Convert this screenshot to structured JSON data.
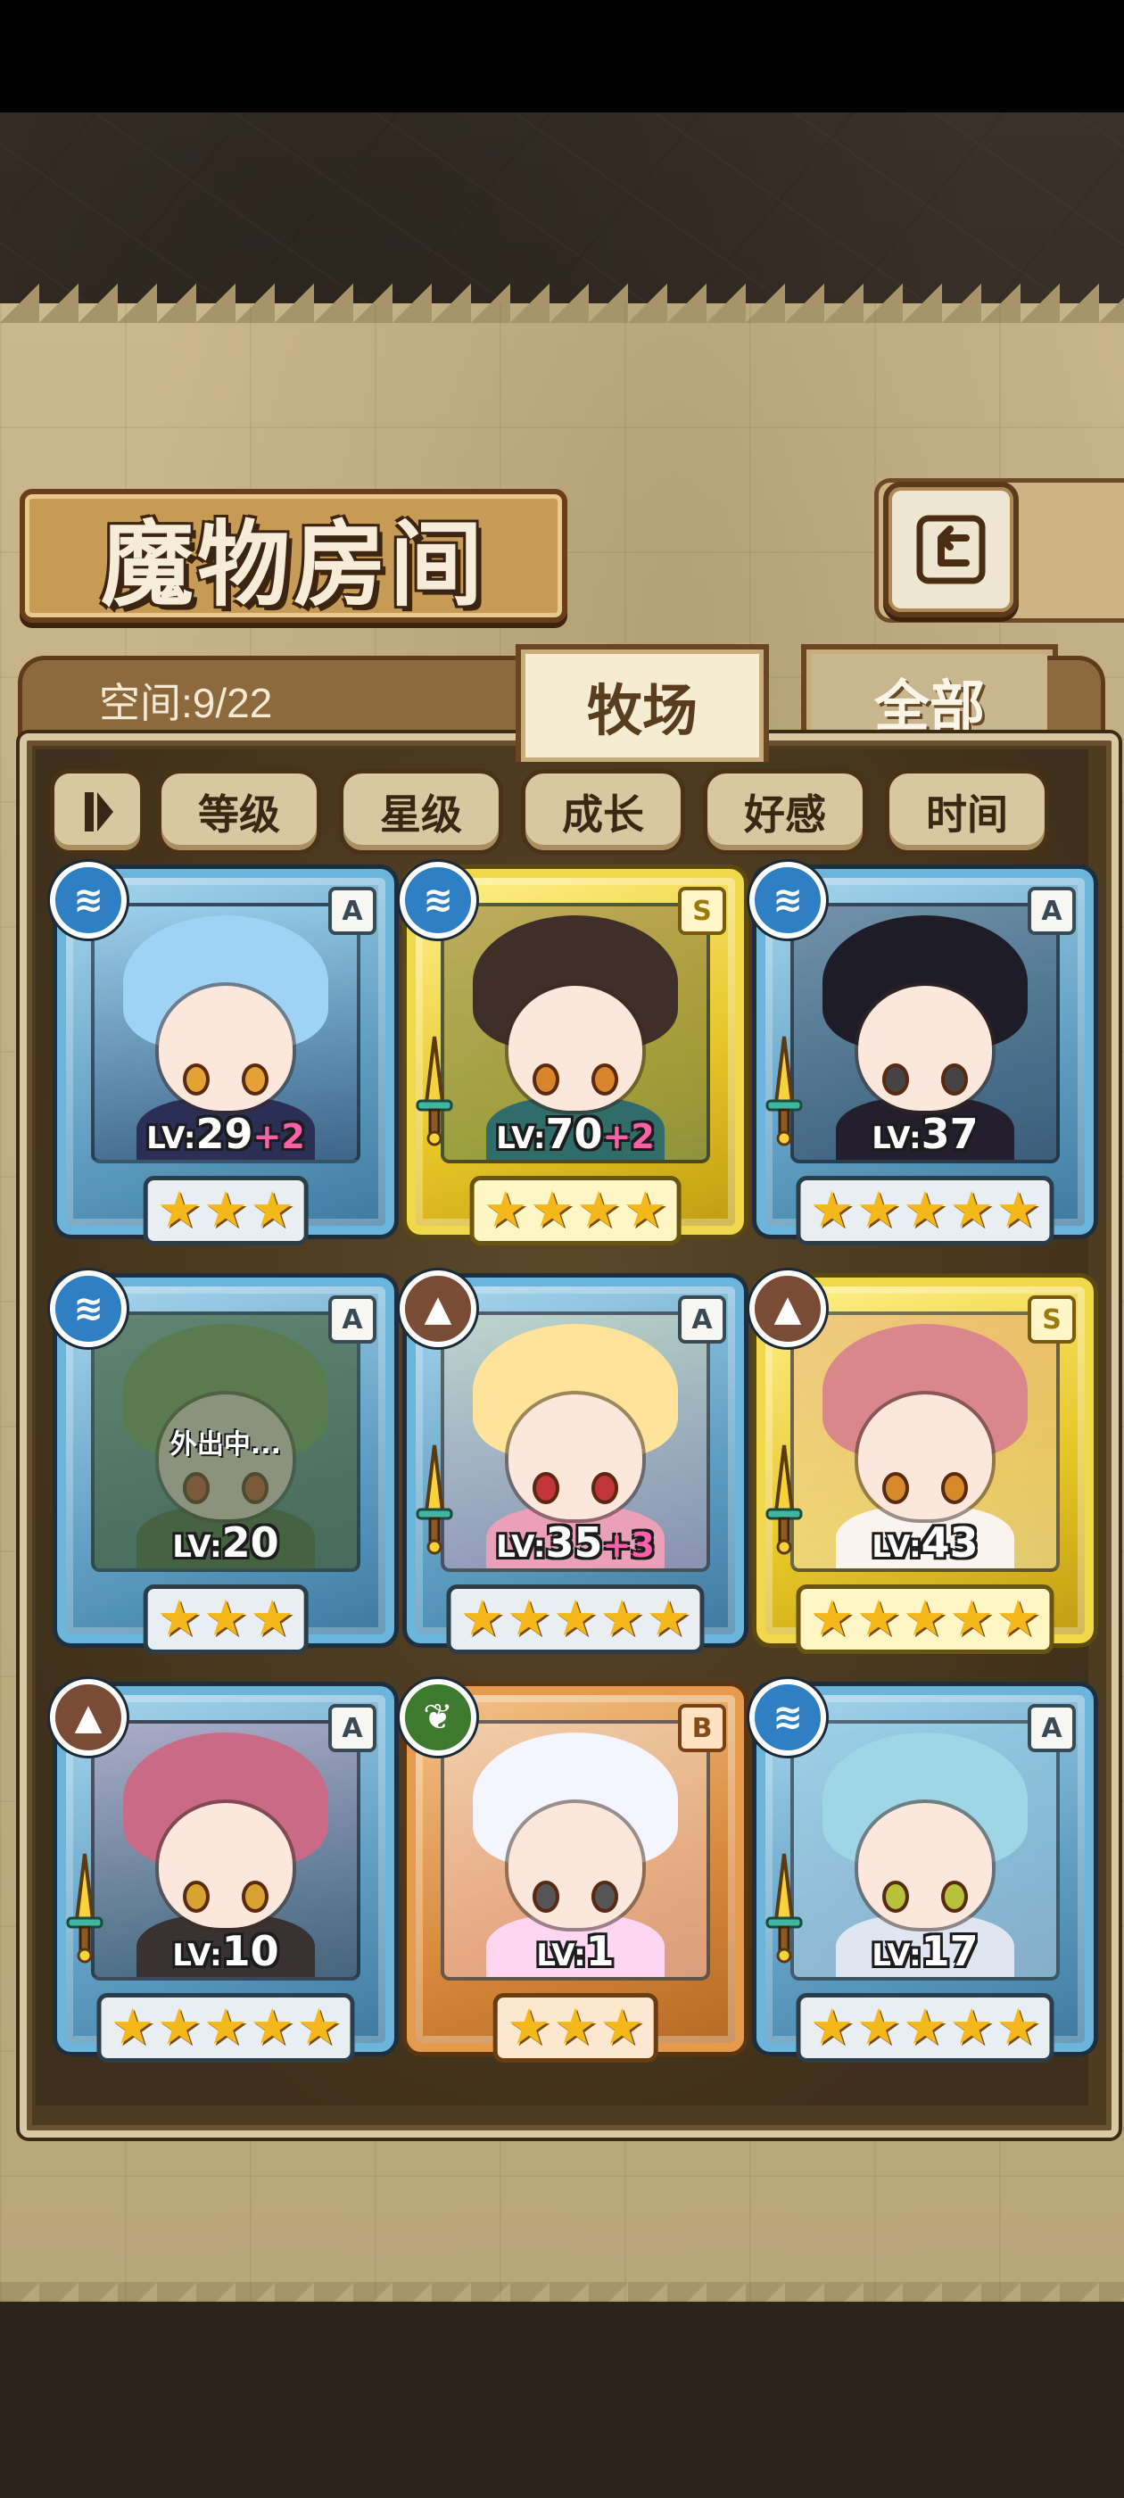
{
  "header": {
    "title": "魔物房间",
    "back_icon": "return-arrow-icon"
  },
  "tabs": {
    "space_label": "空间:9/22",
    "ranch": "牧场",
    "all": "全部",
    "active": "牧场"
  },
  "sort_buttons": [
    {
      "label": "等级"
    },
    {
      "label": "星级"
    },
    {
      "label": "成长"
    },
    {
      "label": "好感"
    },
    {
      "label": "时间"
    }
  ],
  "monsters": [
    {
      "level": "29",
      "bonus": "+2",
      "stars": 3,
      "rank": "A",
      "element": "water",
      "frame": "blue",
      "status": "",
      "hair": "#9fd3f5",
      "body": "#2c2f55",
      "eye": "#e3a233"
    },
    {
      "level": "70",
      "bonus": "+2",
      "stars": 4,
      "rank": "S",
      "element": "water",
      "frame": "gold",
      "status": "",
      "hair": "#3e3028",
      "body": "#2f6c6a",
      "eye": "#d9832b"
    },
    {
      "level": "37",
      "bonus": "",
      "stars": 5,
      "rank": "A",
      "element": "water",
      "frame": "blue",
      "status": "",
      "hair": "#1e1c28",
      "body": "#241f2e",
      "eye": "#444"
    },
    {
      "level": "20",
      "bonus": "",
      "stars": 3,
      "rank": "A",
      "element": "water",
      "frame": "blue",
      "status": "外出中...",
      "hair": "#7aa95f",
      "body": "#496b3a",
      "eye": "#d8502c"
    },
    {
      "level": "35",
      "bonus": "+3",
      "stars": 5,
      "rank": "A",
      "element": "earth",
      "frame": "blue",
      "status": "",
      "hair": "#ffe39a",
      "body": "#e9a0b8",
      "eye": "#c0343a"
    },
    {
      "level": "43",
      "bonus": "",
      "stars": 5,
      "rank": "S",
      "element": "earth",
      "frame": "gold",
      "status": "",
      "hair": "#d9878a",
      "body": "#fbf4ee",
      "eye": "#d88a2b"
    },
    {
      "level": "10",
      "bonus": "",
      "stars": 5,
      "rank": "A",
      "element": "earth",
      "frame": "blue",
      "status": "",
      "hair": "#c96a86",
      "body": "#3a3232",
      "eye": "#d7a230"
    },
    {
      "level": "1",
      "bonus": "",
      "stars": 3,
      "rank": "B",
      "element": "nature",
      "frame": "orange",
      "status": "",
      "hair": "#f5f5ff",
      "body": "#ffd6f1",
      "eye": "#555"
    },
    {
      "level": "17",
      "bonus": "",
      "stars": 5,
      "rank": "A",
      "element": "water",
      "frame": "blue",
      "status": "",
      "hair": "#9fd6e6",
      "body": "#dfe6f2",
      "eye": "#b7c23a"
    }
  ],
  "labels": {
    "lv_prefix": "LV:"
  },
  "colors": {
    "water": "#2e7fc4",
    "earth": "#7a4c35",
    "nature": "#3d7a2e",
    "star": "#f5b81a",
    "bonus": "#ff5fa8"
  }
}
